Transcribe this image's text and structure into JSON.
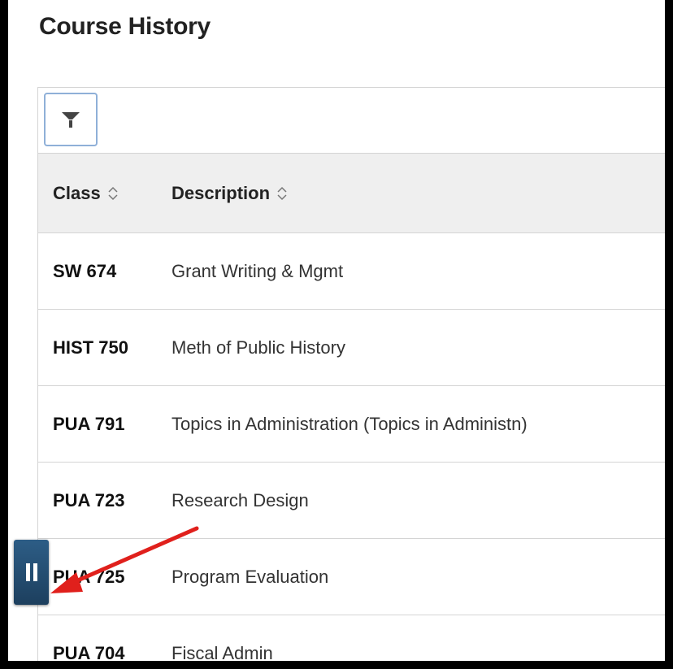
{
  "page": {
    "title": "Course History"
  },
  "toolbar": {
    "filter_icon": "filter-icon"
  },
  "table": {
    "headers": {
      "class": "Class",
      "description": "Description"
    },
    "rows": [
      {
        "class": "SW 674",
        "description": "Grant Writing & Mgmt",
        "more": ":"
      },
      {
        "class": "HIST 750",
        "description": "Meth of Public History",
        "more": ":"
      },
      {
        "class": "PUA 791",
        "description": "Topics in Administration (Topics in Administn)",
        "more": ":"
      },
      {
        "class": "PUA 723",
        "description": "Research Design",
        "more": ":"
      },
      {
        "class": "PUA 725",
        "description": "Program Evaluation",
        "more": ":"
      },
      {
        "class": "PUA 704",
        "description": "Fiscal Admin",
        "more": ":"
      }
    ]
  },
  "overlay": {
    "pause_icon": "pause-icon",
    "arrow_color": "#e0201c"
  },
  "colors": {
    "header_bg": "#efefef",
    "border": "#d4d4d4",
    "pause_bg": "#24496d"
  }
}
